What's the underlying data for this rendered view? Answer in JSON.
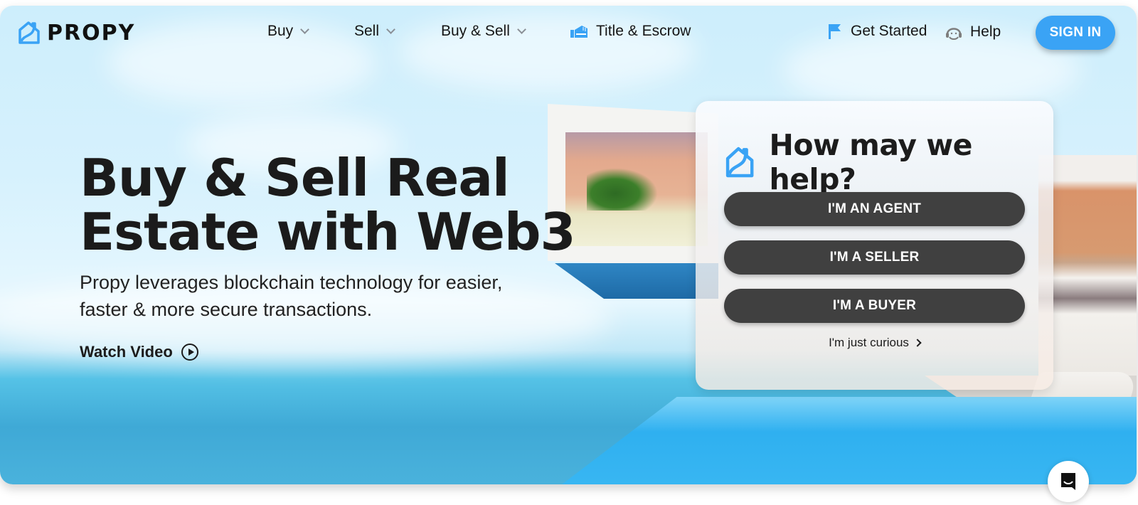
{
  "brand": {
    "name": "PROPY",
    "accent": "#3aa3f5",
    "dark_button": "#404040"
  },
  "nav": {
    "items": [
      {
        "label": "Buy",
        "has_dropdown": true
      },
      {
        "label": "Sell",
        "has_dropdown": true
      },
      {
        "label": "Buy & Sell",
        "has_dropdown": true
      },
      {
        "label": "Title & Escrow",
        "icon": "title-escrow-icon"
      }
    ],
    "get_started": "Get Started",
    "help": "Help",
    "sign_in": "SIGN IN"
  },
  "hero": {
    "headline_line1": "Buy & Sell Real",
    "headline_line2": "Estate with Web3",
    "subline": "Propy leverages blockchain technology for easier, faster & more secure transactions.",
    "watch_video": "Watch Video"
  },
  "help_card": {
    "title": "How may we help?",
    "buttons": [
      {
        "label": "I'M AN AGENT"
      },
      {
        "label": "I'M A SELLER"
      },
      {
        "label": "I'M A BUYER"
      }
    ],
    "curious_link": "I'm just curious"
  },
  "chat_widget": {
    "icon": "chat-icon"
  }
}
